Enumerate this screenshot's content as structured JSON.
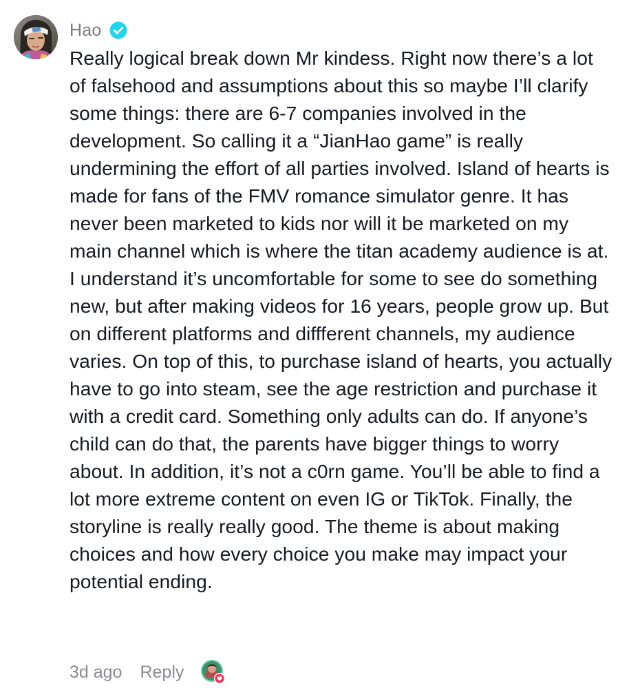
{
  "comment": {
    "author": "Hao",
    "author_verified": true,
    "avatar_icon": "user-avatar-photo",
    "text": "Really logical break down Mr kindess. Right now there’s a lot of falsehood and assumptions about this so maybe I’ll clarify some things: there are 6-7 companies involved in the development. So calling it a “JianHao game” is really undermining the effort of all parties involved. Island of hearts is made for fans of the FMV romance simulator genre. It has never been marketed to kids nor will it be marketed on my main channel which is where the titan academy audience is at. I understand it’s uncomfortable for some to see do something new, but after making videos for 16 years, people grow up. But on different platforms and diffferent channels, my audience varies. On top of this, to purchase island of hearts, you actually have to go into steam, see the age restriction and purchase it with a credit card. Something only adults can do. If anyone’s child can do that, the parents have bigger things to worry about. In addition, it’s not a c0rn game. You’ll be able to find a lot more extreme content on even IG or TikTok. Finally, the storyline is really really good. The theme is about making choices and how every choice you make may impact your potential ending.",
    "timestamp": "3d ago",
    "reply_label": "Reply",
    "creator_liked_icon": "creator-liked-heart-icon"
  },
  "colors": {
    "author": "#7c7c80",
    "text": "#161823",
    "meta": "#8a8b91",
    "verified": "#20d5ec",
    "heart": "#fe2c55"
  }
}
